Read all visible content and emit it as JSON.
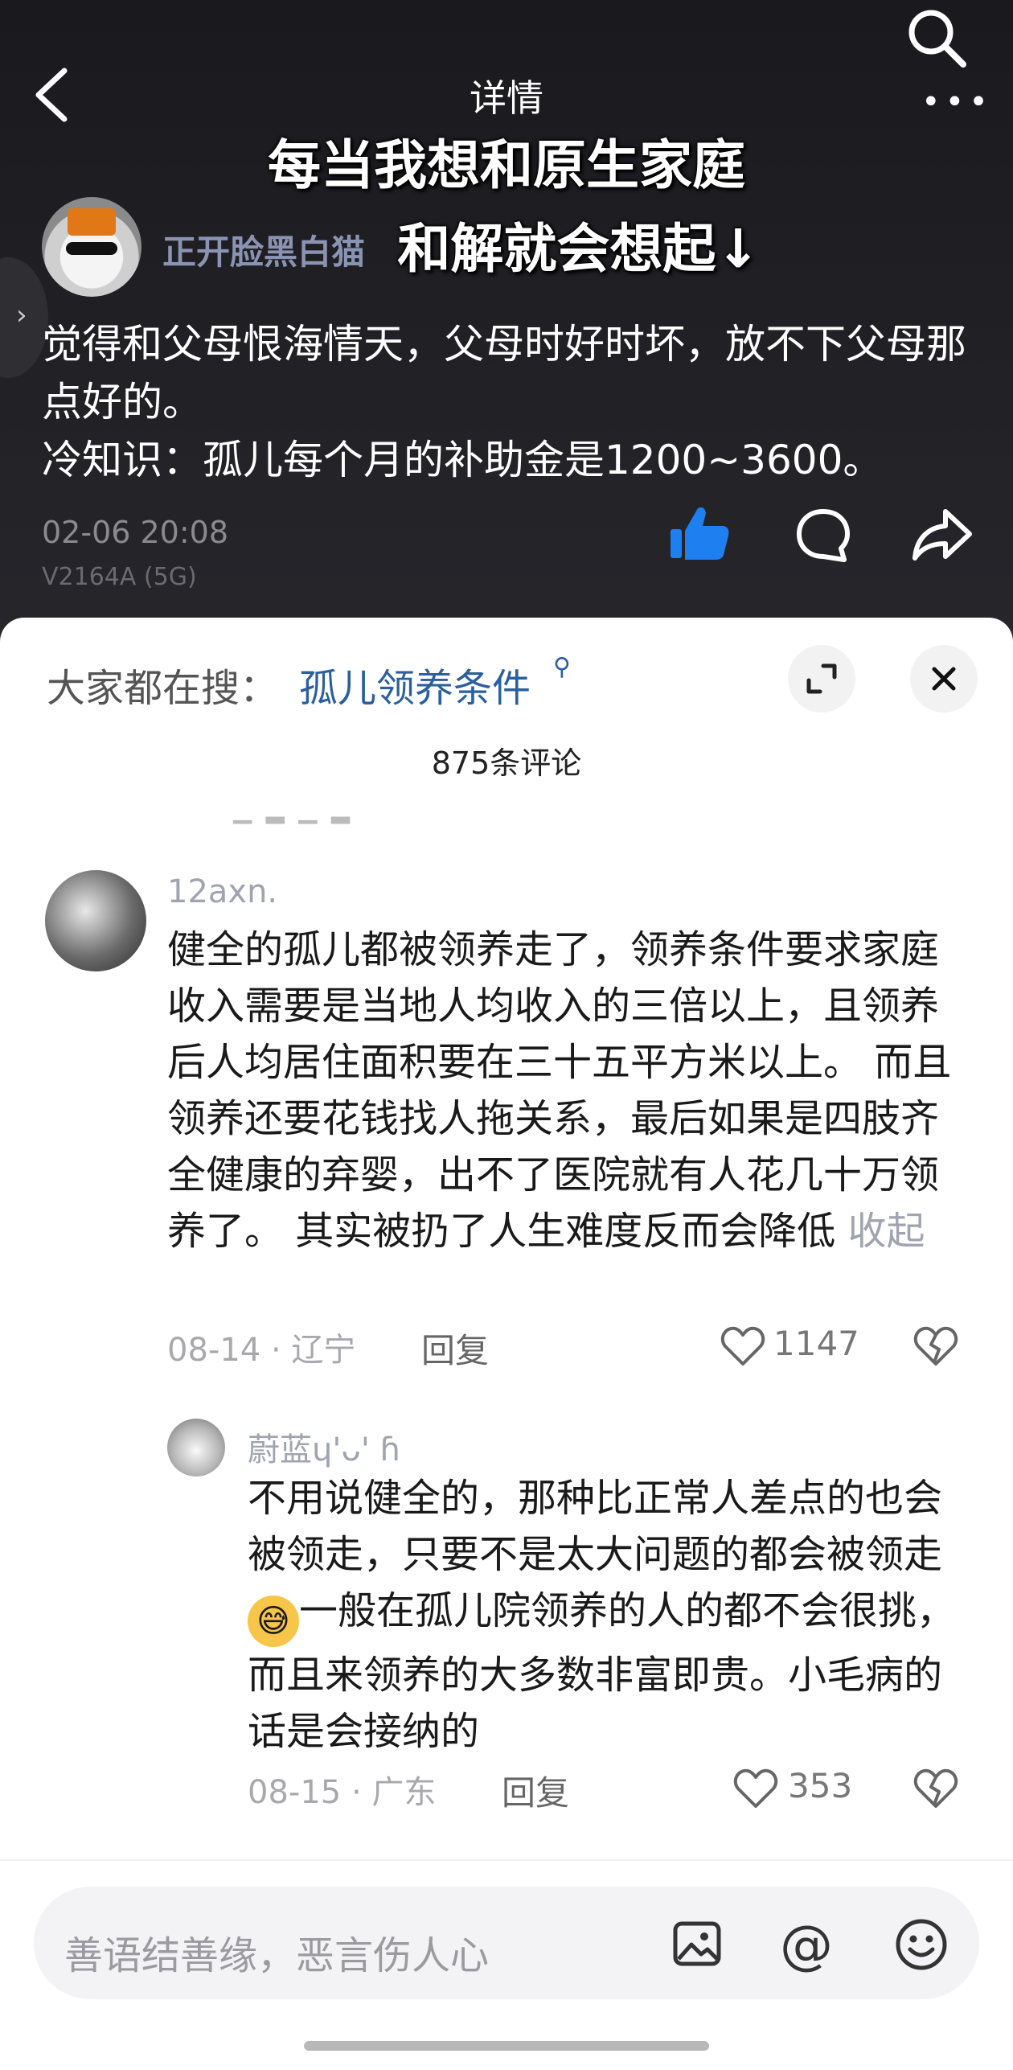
{
  "nav": {
    "title": "详情"
  },
  "overlay": {
    "line1": "每当我想和原生家庭",
    "line2": "和解就会想起↓"
  },
  "post": {
    "author": "正开脸黑白猫",
    "text_line1": "觉得和父母恨海情天，父母时好时坏，放不下父母那点好的。",
    "text_line2": "冷知识：孤儿每个月的补助金是1200~3600。",
    "time": "02-06 20:08",
    "device": "V2164A (5G)"
  },
  "comments_sheet": {
    "hot_label": "大家都在搜：",
    "hot_term": "孤儿领养条件",
    "count": "875条评论",
    "comment": {
      "user": "12axn.",
      "text": "健全的孤儿都被领养走了，领养条件要求家庭收入需要是当地人均收入的三倍以上，且领养后人均居住面积要在三十五平方米以上。 而且领养还要花钱找人拖关系，最后如果是四肢齐全健康的弃婴，出不了医院就有人花几十万领养了。 其实被扔了人生难度反而会降低",
      "collapse": "收起",
      "meta": "08-14 · 辽宁",
      "reply": "回复",
      "likes": "1147"
    },
    "reply_comment": {
      "user": "蔚蓝ɥ'ᴗ' ɦ",
      "text_before": "不用说健全的，那种比正常人差点的也会被领走，只要不是太大问题的都会被领走",
      "emoji": "😅",
      "text_after": "一般在孤儿院领养的人的都不会很挑，而且来领养的大多数非富即贵。小毛病的话是会接纳的",
      "meta": "08-15 · 广东",
      "reply": "回复",
      "likes": "353"
    },
    "input_placeholder": "善语结善缘，恶言伤人心"
  },
  "colors": {
    "like_blue": "#1e7ff0",
    "link_blue": "#2b5f9e",
    "dark_bg": "#1f1f23"
  },
  "icons": [
    "back-icon",
    "search-icon",
    "more-icon",
    "like-icon",
    "comment-icon",
    "share-icon",
    "expand-icon",
    "close-icon",
    "heart-icon",
    "broken-heart-icon",
    "image-icon",
    "at-icon",
    "smile-icon"
  ]
}
